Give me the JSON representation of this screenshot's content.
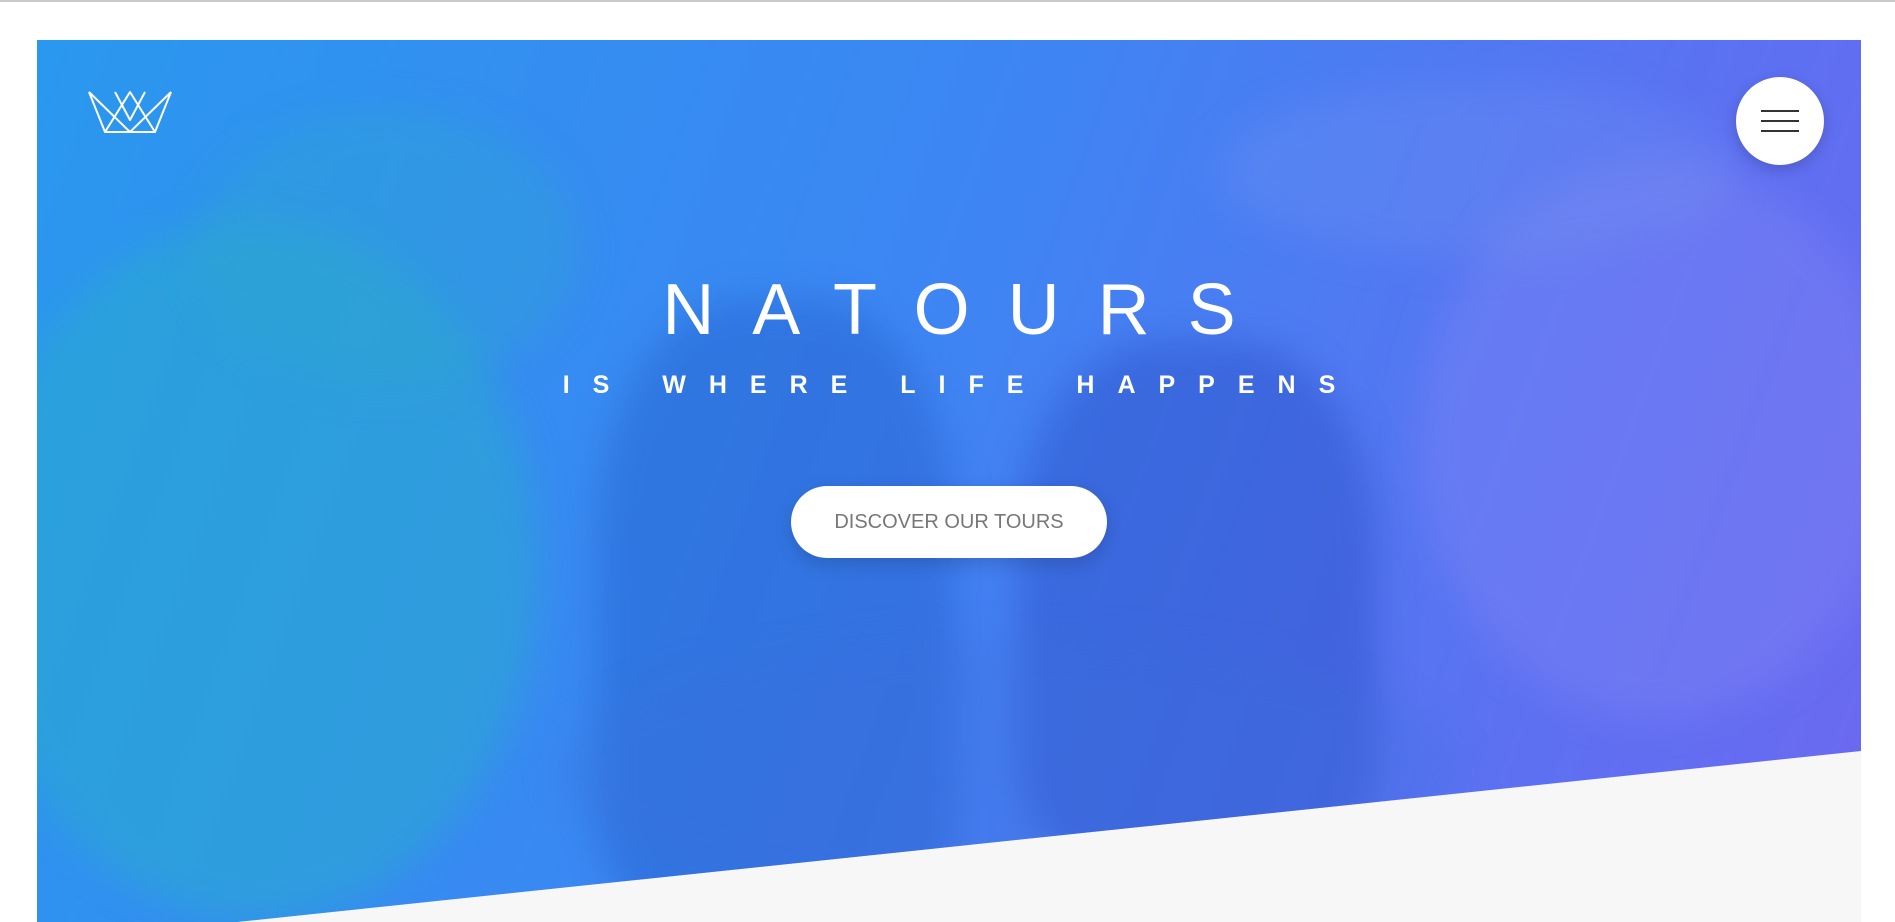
{
  "header": {
    "logo_icon": "crown-logo-icon",
    "menu_icon": "hamburger-icon"
  },
  "hero": {
    "title": "NATOURS",
    "subtitle": "IS WHERE LIFE HAPPENS",
    "cta_label": "DISCOVER OUR TOURS"
  },
  "colors": {
    "gradient_start": "#2a98ee",
    "gradient_end": "#6c69f0",
    "section_background": "#f7f7f7",
    "button_text": "#777777"
  }
}
